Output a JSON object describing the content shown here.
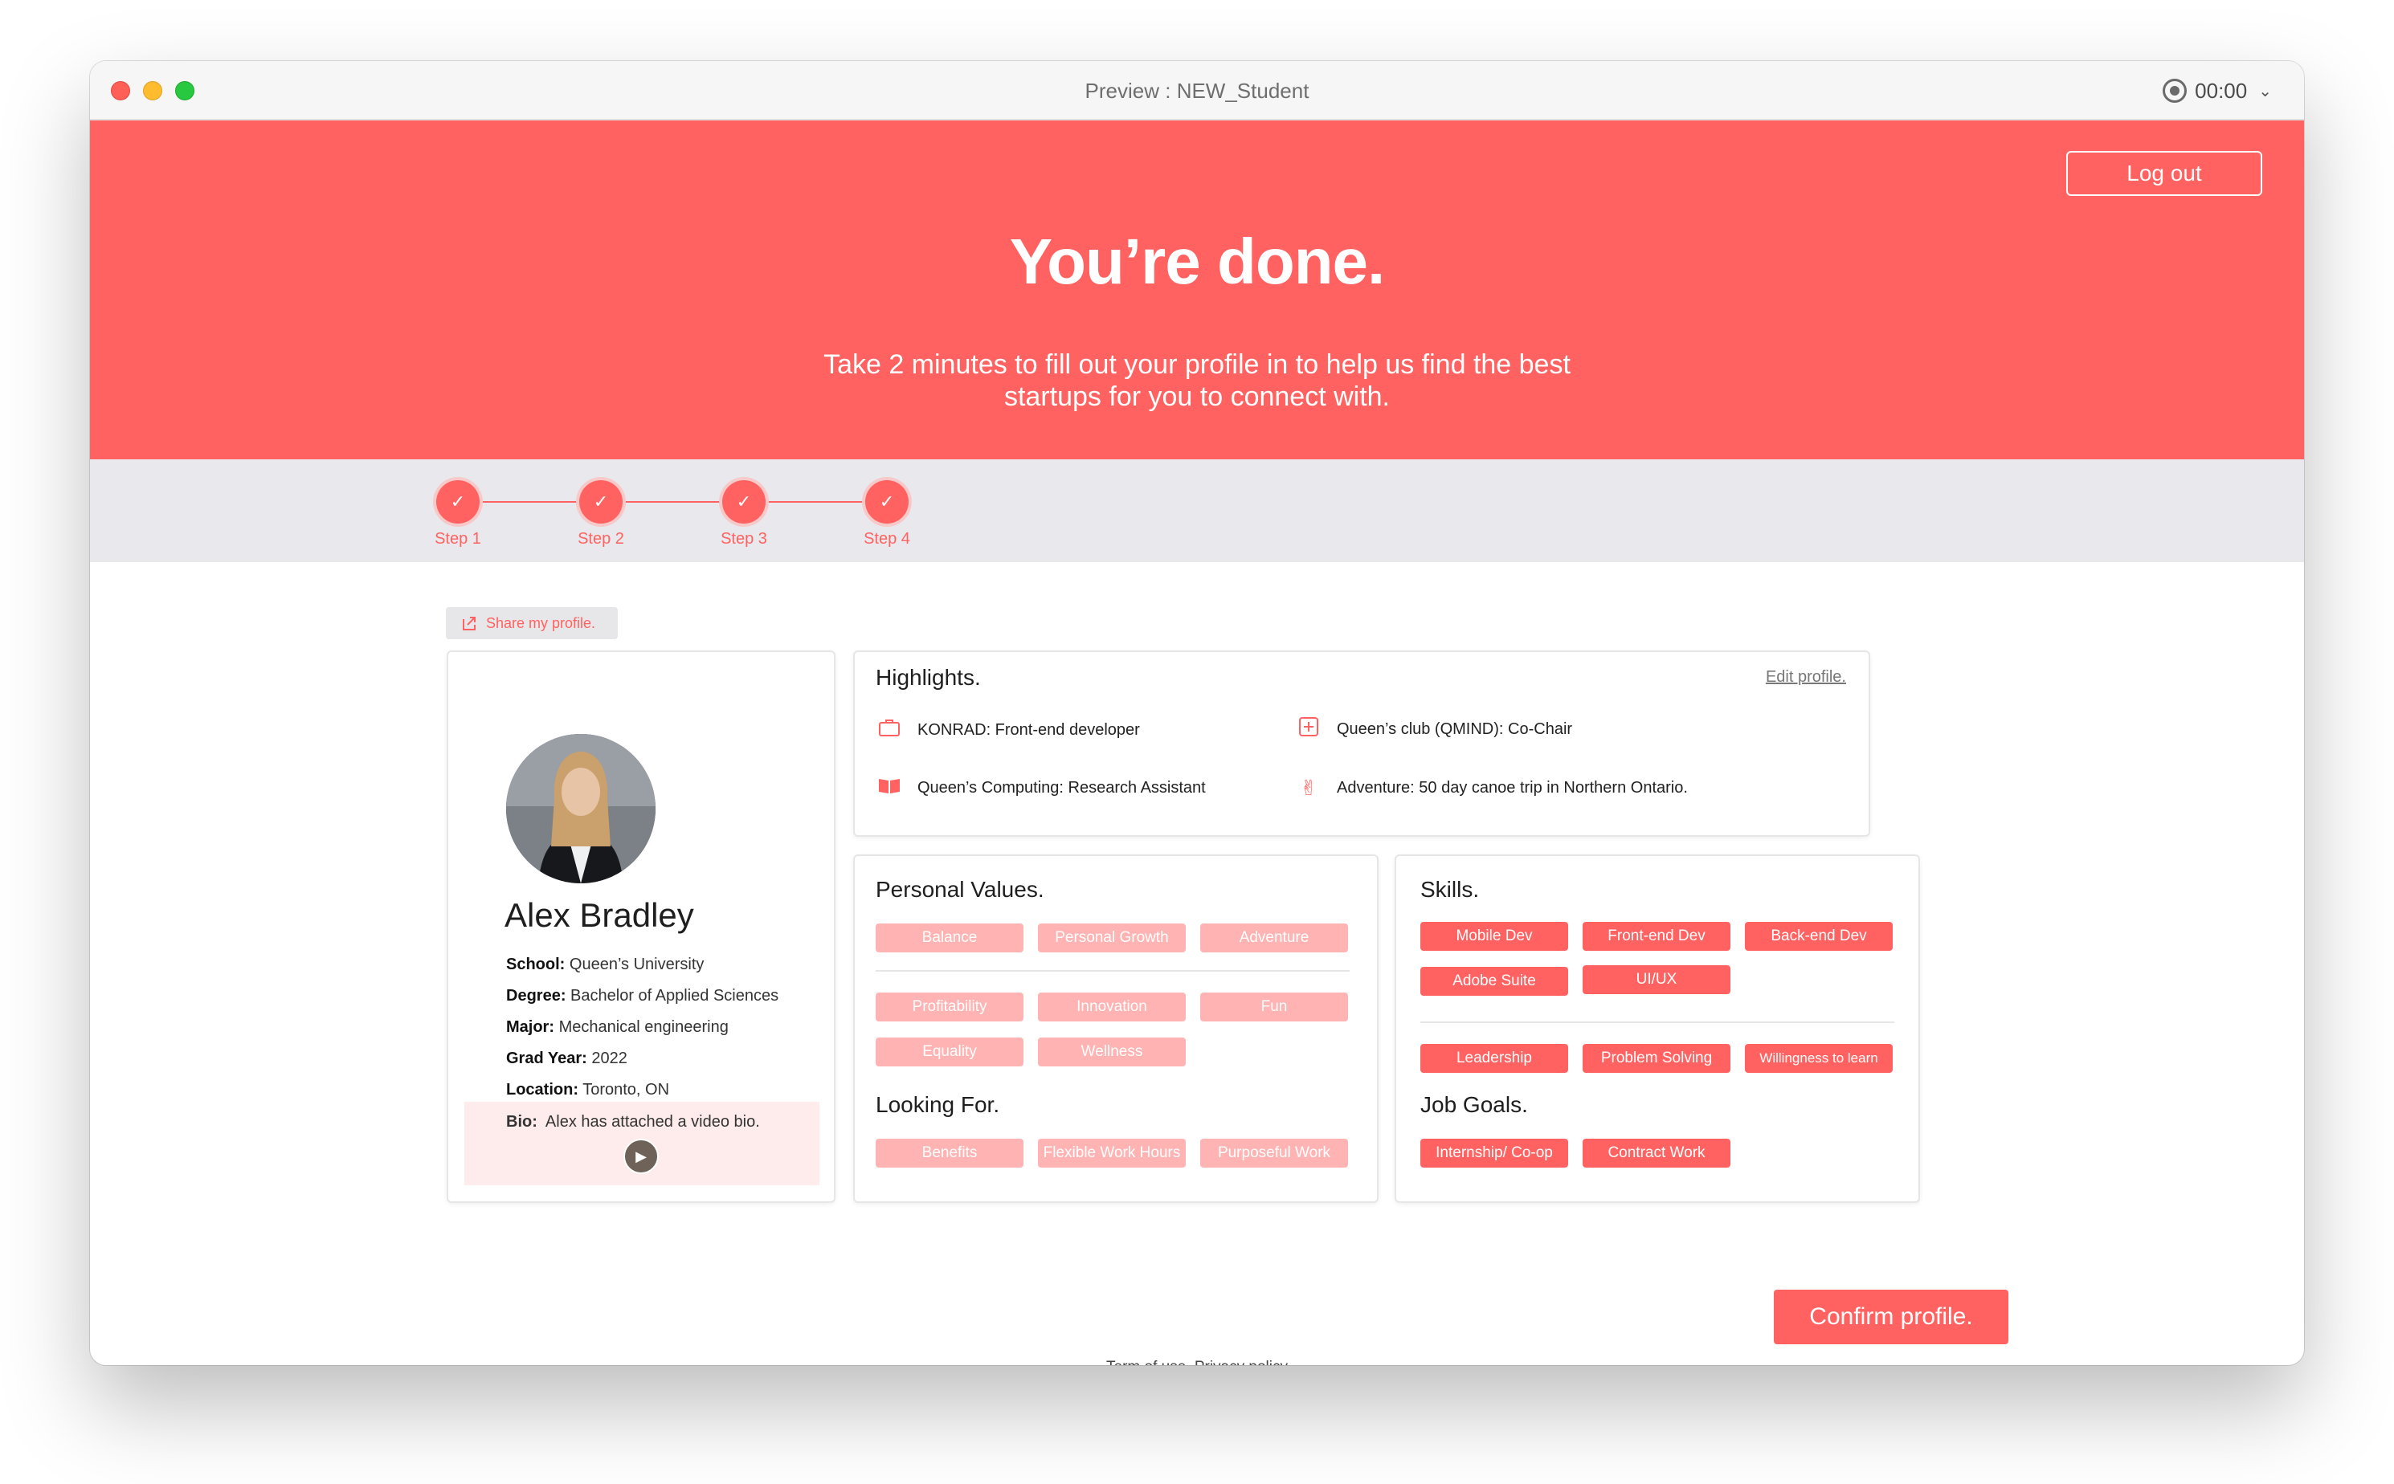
{
  "window": {
    "title": "Preview : NEW_Student",
    "timer": "00:00"
  },
  "hero": {
    "logout_label": "Log out",
    "title": "You’re done.",
    "subtitle": "Take 2 minutes to fill out your profile in to help us find the best startups for you to connect with."
  },
  "steps": [
    "Step 1",
    "Step 2",
    "Step 3",
    "Step 4"
  ],
  "share_label": "Share my profile.",
  "profile": {
    "name": "Alex Bradley",
    "school_label": "School:",
    "school": "Queen’s University",
    "degree_label": "Degree:",
    "degree": "Bachelor of Applied Sciences",
    "major_label": "Major:",
    "major": "Mechanical engineering",
    "grad_label": "Grad Year:",
    "grad": "2022",
    "location_label": "Location:",
    "location": "Toronto, ON",
    "bio_label": "Bio:",
    "bio": "Alex has attached a video bio."
  },
  "highlights": {
    "title": "Highlights.",
    "edit_label": "Edit profile.",
    "items": [
      {
        "icon": "briefcase-icon",
        "text": "KONRAD: Front-end developer"
      },
      {
        "icon": "plus-square-icon",
        "text": "Queen’s club (QMIND): Co-Chair"
      },
      {
        "icon": "book-icon",
        "text": "Queen’s Computing: Research Assistant"
      },
      {
        "icon": "peace-hand-icon",
        "text": "Adventure: 50 day canoe trip in Northern Ontario."
      }
    ]
  },
  "personal_values": {
    "title": "Personal Values.",
    "row1": [
      "Balance",
      "Personal Growth",
      "Adventure"
    ],
    "row2": [
      "Profitability",
      "Innovation",
      "Fun"
    ],
    "row3": [
      "Equality",
      "Wellness"
    ]
  },
  "looking_for": {
    "title": "Looking For.",
    "items": [
      "Benefits",
      "Flexible Work Hours",
      "Purposeful Work"
    ]
  },
  "skills": {
    "title": "Skills.",
    "row1": [
      "Mobile Dev",
      "Front-end Dev",
      "Back-end Dev"
    ],
    "row2": [
      "Adobe Suite",
      "UI/UX"
    ],
    "row3": [
      "Leadership",
      "Problem Solving",
      "Willingness to learn"
    ]
  },
  "job_goals": {
    "title": "Job Goals.",
    "items": [
      "Internship/ Co-op",
      "Contract Work"
    ]
  },
  "confirm_label": "Confirm profile.",
  "footer": "Term of use. Privacy policy",
  "colors": {
    "accent": "#ff6260",
    "soft_tag": "#ffb3b3",
    "stepper_bg": "#e8e8ed",
    "bio_bg": "#fdeceb"
  }
}
